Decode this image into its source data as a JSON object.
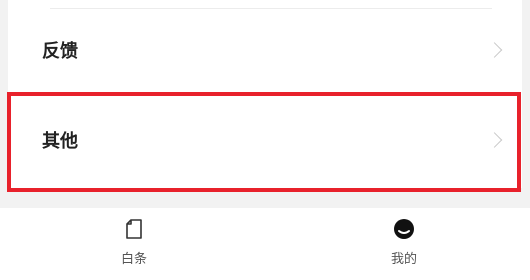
{
  "menu": {
    "items": [
      {
        "label": "反馈"
      },
      {
        "label": "其他"
      }
    ]
  },
  "tabbar": {
    "tabs": [
      {
        "label": "白条",
        "icon": "note-icon"
      },
      {
        "label": "我的",
        "icon": "profile-icon"
      }
    ]
  },
  "colors": {
    "highlight": "#e8212b",
    "background": "#f2f2f2"
  }
}
